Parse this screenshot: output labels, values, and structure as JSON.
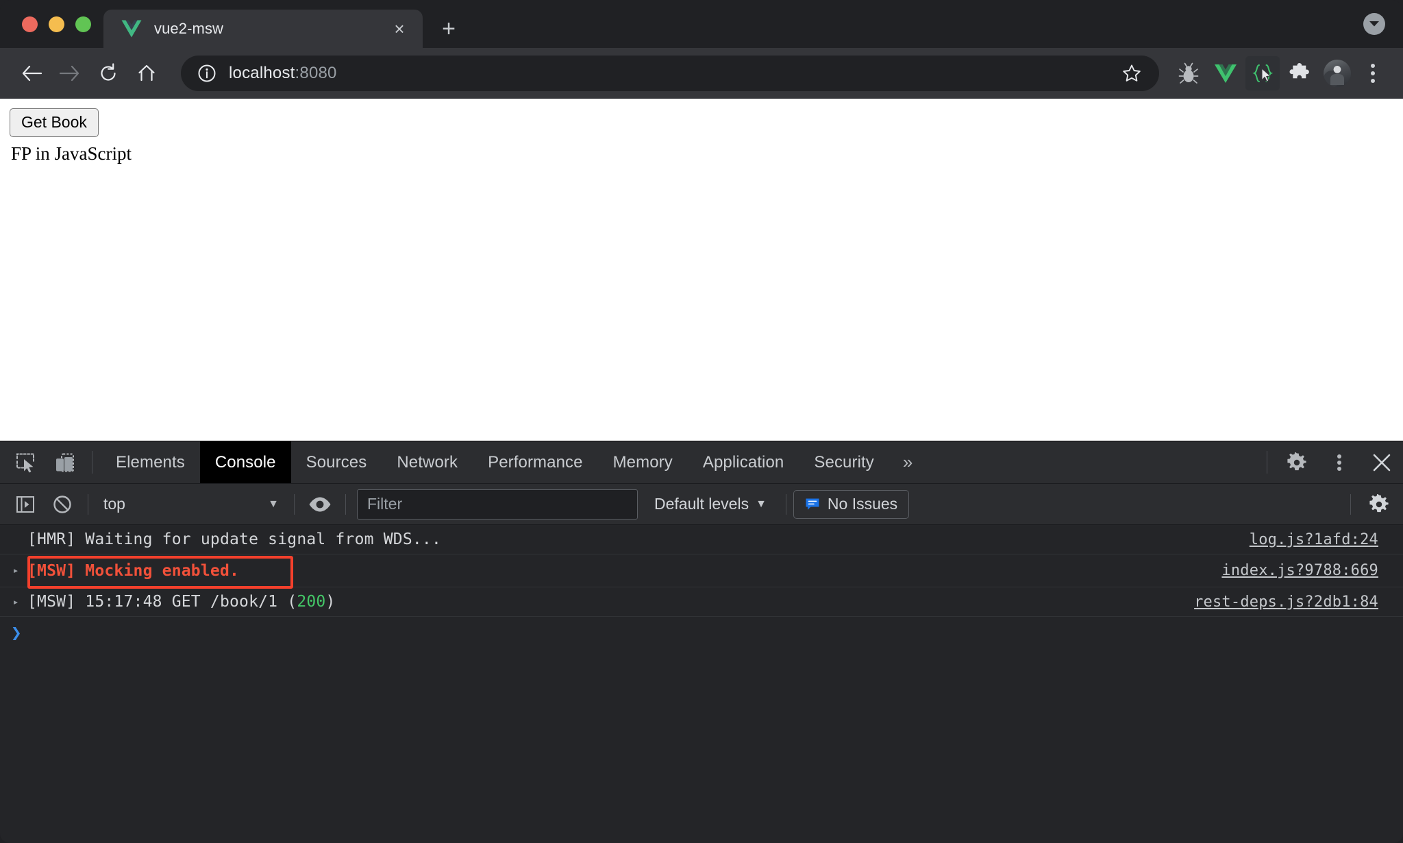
{
  "browser": {
    "traffic_lights": [
      "close",
      "minimize",
      "maximize"
    ],
    "tab": {
      "title": "vue2-msw",
      "favicon": "vue-logo-icon",
      "close_label": "×"
    },
    "new_tab_label": "+",
    "tabstrip_caret": "tab-search-caret-icon",
    "toolbar": {
      "back_label": "←",
      "forward_label": "→",
      "reload_label": "↻",
      "home_label": "⌂",
      "url_host": "localhost",
      "url_port": ":8080",
      "site_info_icon": "info-circle-icon",
      "bookmark_icon": "star-icon",
      "extensions": [
        {
          "name": "bug-extension-icon",
          "label": ""
        },
        {
          "name": "vue-devtools-extension-icon",
          "label": ""
        },
        {
          "name": "code-cursor-extension-icon",
          "label": ""
        },
        {
          "name": "puzzle-extensions-icon",
          "label": ""
        }
      ],
      "avatar": "profile-avatar",
      "menu_icon": "three-dot-menu-icon"
    }
  },
  "page": {
    "button_label": "Get Book",
    "book_title": "FP in JavaScript"
  },
  "devtools": {
    "left_icons": [
      {
        "name": "inspect-element-icon"
      },
      {
        "name": "device-toolbar-icon"
      }
    ],
    "tabs": [
      {
        "label": "Elements",
        "active": false
      },
      {
        "label": "Console",
        "active": true
      },
      {
        "label": "Sources",
        "active": false
      },
      {
        "label": "Network",
        "active": false
      },
      {
        "label": "Performance",
        "active": false
      },
      {
        "label": "Memory",
        "active": false
      },
      {
        "label": "Application",
        "active": false
      },
      {
        "label": "Security",
        "active": false
      }
    ],
    "more_tabs_label": "»",
    "settings_icon": "gear-icon",
    "kebab_icon": "three-dot-menu-icon",
    "close_icon": "close-icon",
    "console_toolbar": {
      "sidebar_toggle_icon": "console-sidebar-icon",
      "clear_console_icon": "clear-console-icon",
      "context_value": "top",
      "context_arrow": "▼",
      "live_expression_icon": "eye-icon",
      "filter_placeholder": "Filter",
      "filter_value": "",
      "levels_label": "Default levels",
      "levels_arrow": "▼",
      "issues_label": "No Issues",
      "issues_icon": "issues-bubble-icon",
      "settings_icon": "gear-icon"
    },
    "messages": [
      {
        "expandable": false,
        "disclosure": "",
        "text": "[HMR] Waiting for update signal from WDS...",
        "source": "log.js?1afd:24",
        "level": "info",
        "highlighted": false
      },
      {
        "expandable": true,
        "disclosure": "▸",
        "text": "[MSW] Mocking enabled.",
        "source": "index.js?9788:669",
        "level": "error",
        "highlighted": true
      },
      {
        "expandable": true,
        "disclosure": "▸",
        "text_prefix": "[MSW] 15:17:48 GET /book/1 (",
        "text_status": "200",
        "text_suffix": ")",
        "source": "rest-deps.js?2db1:84",
        "level": "info",
        "highlighted": false
      }
    ],
    "prompt_chevron": "❯"
  },
  "colors": {
    "annotation_red": "#F4402C",
    "error_text": "#F2513A",
    "status_ok_green": "#44C767",
    "prompt_blue": "#3B8EEA",
    "issues_blue": "#1A73E8",
    "vue_green": "#41B883",
    "devtools_bg": "#242528",
    "toolbar_bg": "#35363A",
    "tabstrip_bg": "#202124"
  }
}
